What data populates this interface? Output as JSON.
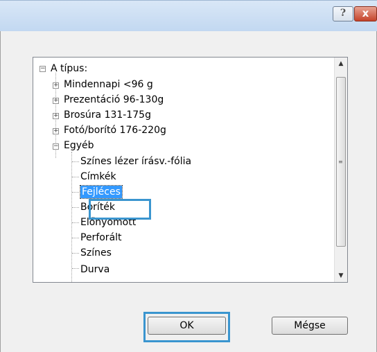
{
  "titlebar": {
    "help_label": "?",
    "close_label": "x"
  },
  "tree": {
    "items": [
      {
        "label": "A típus:",
        "expander": "−"
      },
      {
        "label": "Mindennapi <96 g",
        "expander": "+"
      },
      {
        "label": "Prezentáció 96-130g",
        "expander": "+"
      },
      {
        "label": "Brosúra 131-175g",
        "expander": "+"
      },
      {
        "label": "Fotó/borító 176-220g",
        "expander": "+"
      },
      {
        "label": "Egyéb",
        "expander": "−"
      },
      {
        "label": "Színes lézer írásv.-fólia"
      },
      {
        "label": "Címkék"
      },
      {
        "label": "Fejléces"
      },
      {
        "label": "Boríték"
      },
      {
        "label": "Előnyomott"
      },
      {
        "label": "Perforált"
      },
      {
        "label": "Színes"
      },
      {
        "label": "Durva"
      }
    ],
    "selected": "Fejléces"
  },
  "scrollbar": {
    "up": "▲",
    "down": "▼",
    "grip": "≡"
  },
  "buttons": {
    "ok": "OK",
    "cancel": "Mégse"
  }
}
